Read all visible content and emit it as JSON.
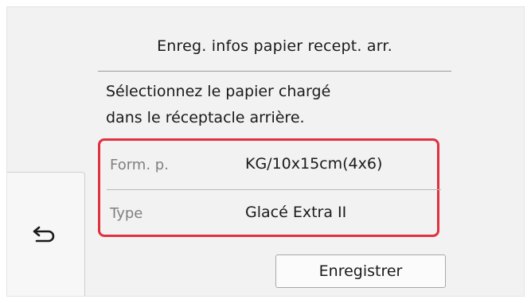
{
  "screen": {
    "title": "Enreg. infos papier recept. arr.",
    "instruction": {
      "line1": "Sélectionnez le papier chargé",
      "line2": "dans le réceptacle arrière."
    },
    "settings": [
      {
        "label": "Form. p.",
        "value": "KG/10x15cm(4x6)"
      },
      {
        "label": "Type",
        "value": "Glacé Extra II"
      }
    ],
    "register_button": {
      "label": "Enregistrer"
    },
    "back_button": {
      "icon": "back-arrow-icon"
    },
    "colors": {
      "highlight_border": "#e1303f",
      "background": "#f2f2f2",
      "label_gray": "#808080"
    }
  }
}
